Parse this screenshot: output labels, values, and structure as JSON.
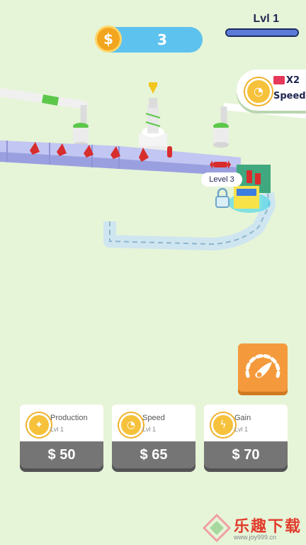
{
  "hud": {
    "coin_icon_label": "$",
    "coins": "3",
    "level": "Lvl 1",
    "level_progress": 1.0
  },
  "speed_boost": {
    "multiplier": "X2",
    "label": "Speed"
  },
  "machine_tag": "Level 3",
  "boost_button_icon": "speedometer-icon",
  "upgrades": [
    {
      "name": "Production",
      "level": "Lvl 1",
      "price": "$ 50",
      "icon": "candy-icon"
    },
    {
      "name": "Speed",
      "level": "Lvl 1",
      "price": "$ 65",
      "icon": "speedometer-icon"
    },
    {
      "name": "Gain",
      "level": "Lvl 1",
      "price": "$ 70",
      "icon": "lightning-icon"
    }
  ],
  "watermark": {
    "text": "乐趣下载",
    "url": "www.joy999.cn"
  },
  "colors": {
    "background": "#e6f4d8",
    "coin_pill": "#5ec2ee",
    "coin": "#f2a51e",
    "boost": "#f49a3c",
    "price_button": "#757575",
    "conveyor": "#a8aee8",
    "candy": "#d82d2d"
  }
}
